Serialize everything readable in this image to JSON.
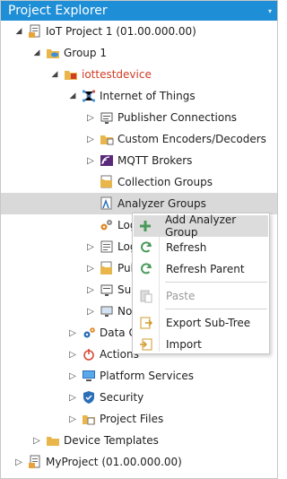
{
  "panel": {
    "title": "Project Explorer",
    "title_dropdown": "▾"
  },
  "tree": [
    {
      "label": "IoT Project 1 (01.00.000.00)",
      "icon": "project-icon",
      "arrow": "expanded"
    },
    {
      "label": "Group 1",
      "icon": "folder-cloud-icon",
      "arrow": "expanded"
    },
    {
      "label": "iottestdevice",
      "icon": "device-icon",
      "arrow": "expanded",
      "color": "#d13c24"
    },
    {
      "label": "Internet of Things",
      "icon": "iot-icon",
      "arrow": "expanded"
    },
    {
      "label": "Publisher Connections",
      "icon": "publisher-connections-icon",
      "arrow": "collapsed"
    },
    {
      "label": "Custom Encoders/Decoders",
      "icon": "encoders-icon",
      "arrow": "collapsed"
    },
    {
      "label": "MQTT Brokers",
      "icon": "mqtt-icon",
      "arrow": "collapsed"
    },
    {
      "label": "Collection Groups",
      "icon": "collection-groups-icon",
      "arrow": "none"
    },
    {
      "label": "Analyzer Groups",
      "icon": "analyzer-groups-icon",
      "arrow": "none",
      "selected": true
    },
    {
      "label": "Log",
      "icon": "gears-icon",
      "arrow": "none"
    },
    {
      "label": "Log",
      "icon": "log-icon",
      "arrow": "collapsed"
    },
    {
      "label": "Pub",
      "icon": "publisher-icon",
      "arrow": "collapsed"
    },
    {
      "label": "Sub",
      "icon": "subscriber-icon",
      "arrow": "collapsed"
    },
    {
      "label": "No",
      "icon": "node-icon",
      "arrow": "collapsed"
    },
    {
      "label": "Data Co",
      "icon": "data-collection-icon",
      "arrow": "collapsed"
    },
    {
      "label": "Actions",
      "icon": "actions-icon",
      "arrow": "collapsed"
    },
    {
      "label": "Platform Services",
      "icon": "platform-services-icon",
      "arrow": "collapsed"
    },
    {
      "label": "Security",
      "icon": "security-icon",
      "arrow": "collapsed"
    },
    {
      "label": "Project Files",
      "icon": "project-files-icon",
      "arrow": "collapsed"
    },
    {
      "label": "Device Templates",
      "icon": "folder-icon",
      "arrow": "collapsed"
    },
    {
      "label": "MyProject (01.00.000.00)",
      "icon": "project-icon",
      "arrow": "collapsed"
    }
  ],
  "context_menu": {
    "items": [
      {
        "label": "Add Analyzer Group",
        "icon": "add-icon",
        "enabled": true
      },
      {
        "label": "Refresh",
        "icon": "refresh-icon",
        "enabled": true
      },
      {
        "label": "Refresh Parent",
        "icon": "refresh-parent-icon",
        "enabled": true
      },
      {
        "label": "Paste",
        "icon": "paste-icon",
        "enabled": false
      },
      {
        "label": "Export Sub-Tree",
        "icon": "export-icon",
        "enabled": true
      },
      {
        "label": "Import",
        "icon": "import-icon",
        "enabled": true
      }
    ]
  },
  "colors": {
    "title_bar": "#1e8ed6",
    "device_label": "#d13c24",
    "selection": "#d9d9d9",
    "menu_hover": "#dcdcdc"
  }
}
